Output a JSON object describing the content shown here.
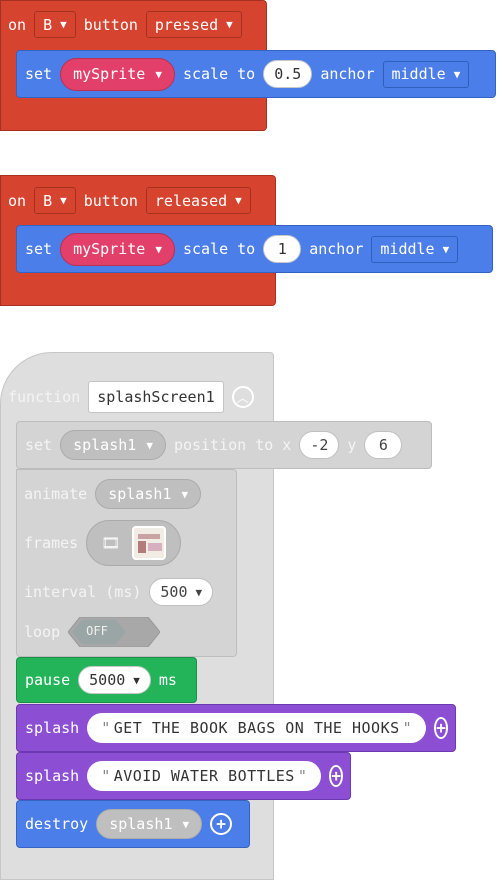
{
  "event_pressed": {
    "on": "on",
    "button": "B",
    "button_word": "button",
    "state": "pressed",
    "set": "set",
    "sprite": "mySprite",
    "scale_to": "scale to",
    "value": "0.5",
    "anchor": "anchor",
    "anchor_value": "middle"
  },
  "event_released": {
    "on": "on",
    "button": "B",
    "button_word": "button",
    "state": "released",
    "set": "set",
    "sprite": "mySprite",
    "scale_to": "scale to",
    "value": "1",
    "anchor": "anchor",
    "anchor_value": "middle"
  },
  "function_block": {
    "keyword": "function",
    "name": "splashScreen1",
    "set_row": {
      "set": "set",
      "sprite": "splash1",
      "position_to_x": "position to x",
      "x": "-2",
      "y_label": "y",
      "y": "6"
    },
    "animate_row": {
      "animate": "animate",
      "sprite": "splash1",
      "frames": "frames",
      "interval": "interval (ms)",
      "interval_value": "500",
      "loop": "loop",
      "loop_state": "OFF"
    },
    "pause_row": {
      "pause": "pause",
      "value": "5000",
      "unit": "ms"
    },
    "splash_rows": [
      {
        "label": "splash",
        "text": "GET THE BOOK BAGS ON THE HOOKS"
      },
      {
        "label": "splash",
        "text": "AVOID WATER BOTTLES"
      }
    ],
    "destroy_row": {
      "destroy": "destroy",
      "sprite": "splash1"
    }
  },
  "colors": {
    "event": "#d6432e",
    "sprite_block": "#4b7ee8",
    "sprite_pill": "#e23f6a",
    "disabled": "#d4d4d4",
    "loops": "#23b45a",
    "game": "#8c4fd4"
  },
  "icons": [
    "caret-down-icon",
    "collapse-icon",
    "film-icon",
    "add-icon",
    "open-quote-icon",
    "close-quote-icon"
  ]
}
